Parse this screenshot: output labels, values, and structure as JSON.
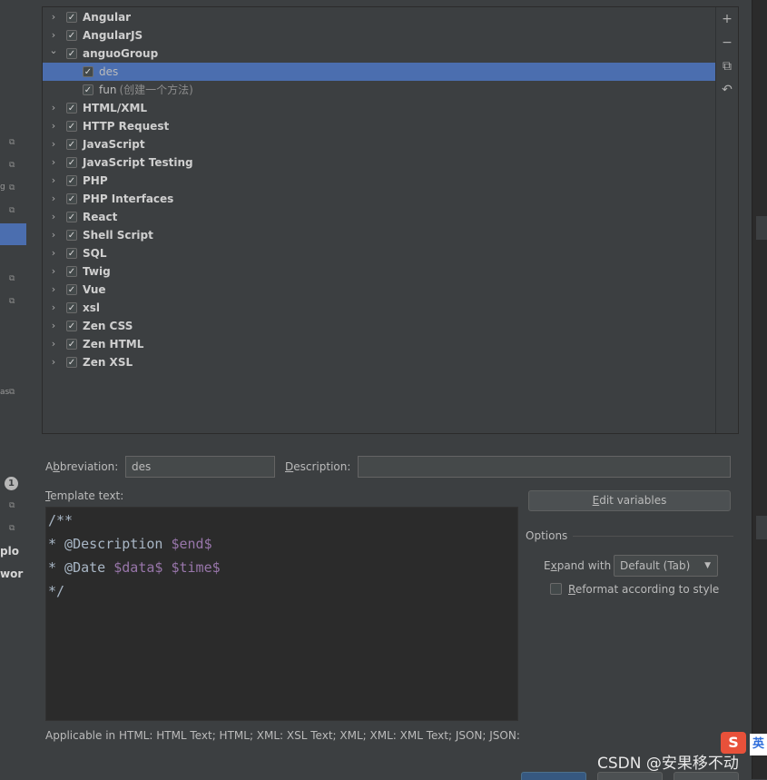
{
  "tree": {
    "rows": [
      {
        "label": "Angular",
        "kind": "group",
        "expanded": false,
        "checked": true
      },
      {
        "label": "AngularJS",
        "kind": "group",
        "expanded": false,
        "checked": true
      },
      {
        "label": "anguoGroup",
        "kind": "group",
        "expanded": true,
        "checked": true
      },
      {
        "label": "des",
        "kind": "item",
        "checked": true,
        "selected": true
      },
      {
        "label": "fun",
        "description": "(创建一个方法)",
        "kind": "item",
        "checked": true
      },
      {
        "label": "HTML/XML",
        "kind": "group",
        "expanded": false,
        "checked": true
      },
      {
        "label": "HTTP Request",
        "kind": "group",
        "expanded": false,
        "checked": true
      },
      {
        "label": "JavaScript",
        "kind": "group",
        "expanded": false,
        "checked": true
      },
      {
        "label": "JavaScript Testing",
        "kind": "group",
        "expanded": false,
        "checked": true
      },
      {
        "label": "PHP",
        "kind": "group",
        "expanded": false,
        "checked": true
      },
      {
        "label": "PHP Interfaces",
        "kind": "group",
        "expanded": false,
        "checked": true
      },
      {
        "label": "React",
        "kind": "group",
        "expanded": false,
        "checked": true
      },
      {
        "label": "Shell Script",
        "kind": "group",
        "expanded": false,
        "checked": true
      },
      {
        "label": "SQL",
        "kind": "group",
        "expanded": false,
        "checked": true
      },
      {
        "label": "Twig",
        "kind": "group",
        "expanded": false,
        "checked": true
      },
      {
        "label": "Vue",
        "kind": "group",
        "expanded": false,
        "checked": true
      },
      {
        "label": "xsl",
        "kind": "group",
        "expanded": false,
        "checked": true
      },
      {
        "label": "Zen CSS",
        "kind": "group",
        "expanded": false,
        "checked": true
      },
      {
        "label": "Zen HTML",
        "kind": "group",
        "expanded": false,
        "checked": true
      },
      {
        "label": "Zen XSL",
        "kind": "group",
        "expanded": false,
        "checked": true
      }
    ],
    "toolbar": [
      {
        "name": "add-icon",
        "glyph": "+"
      },
      {
        "name": "remove-icon",
        "glyph": "−"
      },
      {
        "name": "copy-icon",
        "glyph": "⧉"
      },
      {
        "name": "restore-icon",
        "glyph": "↶"
      }
    ]
  },
  "form": {
    "abbreviation_label_pre": "A",
    "abbreviation_label_u": "b",
    "abbreviation_label_post": "breviation:",
    "abbreviation_value": "des",
    "description_label_u": "D",
    "description_label_post": "escription:",
    "description_value": "",
    "template_label_u": "T",
    "template_label_post": "emplate text:",
    "edit_variables_u": "E",
    "edit_variables_post": "dit variables",
    "options_title": "Options",
    "expand_label_pre": "E",
    "expand_label_u": "x",
    "expand_label_post": "pand with",
    "expand_value": "Default (Tab)",
    "reformat_u": "R",
    "reformat_post": "eformat according to style",
    "reformat_checked": false,
    "applicable": "Applicable in HTML: HTML Text; HTML; XML: XSL Text; XML; XML: XML Text; JSON; JSON:"
  },
  "template_code": {
    "line1": "/**",
    "line2_a": "* @Description ",
    "line2_var": "$end$",
    "line3_a": "* @Date ",
    "line3_var1": "$data$",
    "line3_sp": " ",
    "line3_var2": "$time$",
    "line4": "*/"
  },
  "left_strip": {
    "frag_plo": "plo",
    "frag_wor": "wor",
    "frag_g": "g",
    "frag_as": "as",
    "badge": "1"
  },
  "watermark": "CSDN @安果移不动",
  "ime": {
    "logo": "S",
    "lang": "英"
  },
  "colors": {
    "background": "#3c3f41",
    "selection": "#4b6eaf",
    "editor_bg": "#2b2b2b",
    "template_var": "#9876aa"
  }
}
